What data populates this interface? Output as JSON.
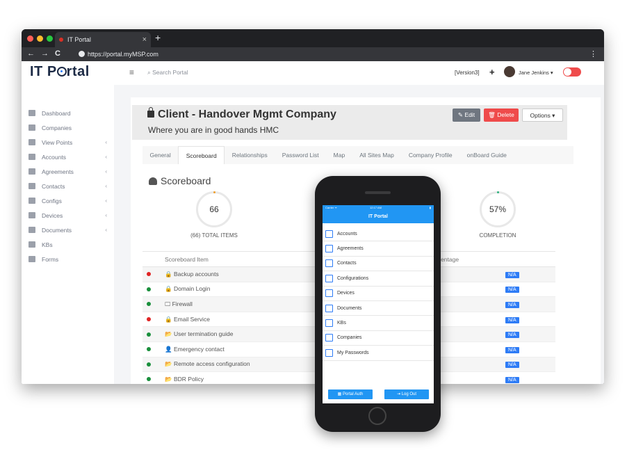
{
  "browser": {
    "tab_title": "IT Portal",
    "tab_close": "×",
    "new_tab": "+",
    "url": "https://portal.myMSP.com",
    "back": "←",
    "forward": "→",
    "reload": "C",
    "menu": "⋮",
    "traffic_colors": [
      "#ff5f57",
      "#febc2e",
      "#28c840"
    ]
  },
  "sidebar": {
    "logo": {
      "first": "IT P",
      "rest": "rtal"
    },
    "items": [
      {
        "label": "Dashboard",
        "chevron": ""
      },
      {
        "label": "Companies",
        "chevron": ""
      },
      {
        "label": "View Points",
        "chevron": "‹"
      },
      {
        "label": "Accounts",
        "chevron": "‹"
      },
      {
        "label": "Agreements",
        "chevron": "‹"
      },
      {
        "label": "Contacts",
        "chevron": "‹"
      },
      {
        "label": "Configs",
        "chevron": "‹"
      },
      {
        "label": "Devices",
        "chevron": "‹"
      },
      {
        "label": "Documents",
        "chevron": "‹"
      },
      {
        "label": "KBs",
        "chevron": ""
      },
      {
        "label": "Forms",
        "chevron": ""
      }
    ]
  },
  "topbar": {
    "menu": "≡",
    "search_placeholder": "⌕  Search Portal",
    "version": "[Version3]",
    "plus": "+",
    "user": "Jane Jenkins ▾"
  },
  "client": {
    "title": "Client - Handover Mgmt Company",
    "subtitle": "Where you are in good hands HMC",
    "edit": "✎ Edit",
    "delete": "🗑 Delete",
    "options": "Options ▾"
  },
  "tabs": [
    "General",
    "Scoreboard",
    "Relationships",
    "Password List",
    "Map",
    "All Sites Map",
    "Company Profile",
    "onBoard Guide"
  ],
  "scoreboard": {
    "title": "Scoreboard",
    "total_value": "66",
    "total_label": "(66) TOTAL ITEMS",
    "completion_value": "57%",
    "completion_label": "COMPLETION",
    "col_item": "Scoreboard Item",
    "col_percentage": "rcentage",
    "rows": [
      {
        "status": "#e02424",
        "icon": "🔒",
        "name": "Backup accounts",
        "badge": "N/A"
      },
      {
        "status": "#1a8f3c",
        "icon": "🔒",
        "name": "Domain Login",
        "badge": "N/A"
      },
      {
        "status": "#1a8f3c",
        "icon": "🖵",
        "name": "Firewall",
        "badge": "N/A"
      },
      {
        "status": "#e02424",
        "icon": "🔒",
        "name": "Email Service",
        "badge": "N/A"
      },
      {
        "status": "#1a8f3c",
        "icon": "📂",
        "name": "User termination guide",
        "badge": "N/A"
      },
      {
        "status": "#1a8f3c",
        "icon": "👤",
        "name": "Emergency contact",
        "badge": "N/A"
      },
      {
        "status": "#1a8f3c",
        "icon": "📂",
        "name": "Remote access configuration",
        "badge": "N/A"
      },
      {
        "status": "#1a8f3c",
        "icon": "📂",
        "name": "BDR Policy",
        "badge": "N/A"
      }
    ]
  },
  "phone": {
    "carrier": "Carrier ᯤ",
    "time": "12:17 AM",
    "battery": "▮",
    "title": "IT Portal",
    "items": [
      "Accounts",
      "Agreements",
      "Contacts",
      "Configurations",
      "Devices",
      "Documents",
      "KBs",
      "Companies",
      "My Passwords"
    ],
    "portal_auth": "▦ Portal Auth",
    "log_out": "⇥ Log Out"
  },
  "colors": {
    "accent": "#2196f3",
    "danger": "#ef4b4b"
  }
}
